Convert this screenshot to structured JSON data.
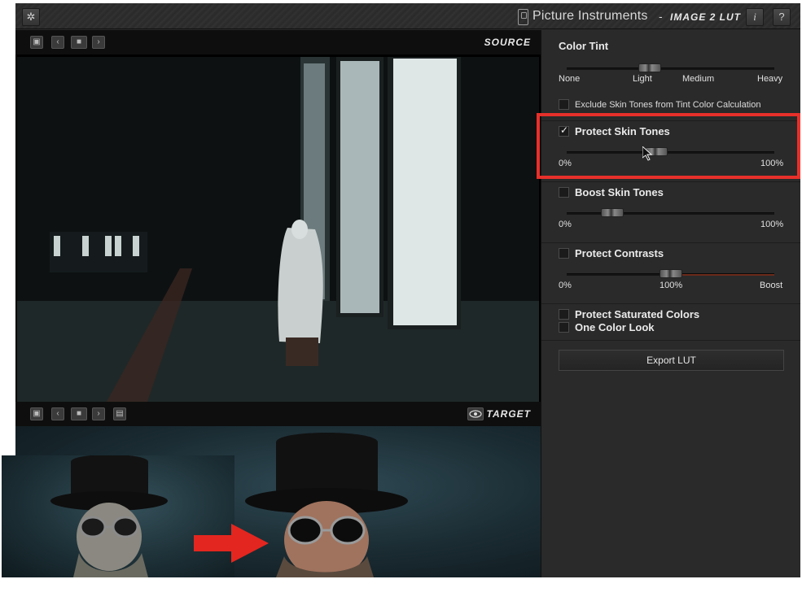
{
  "titlebar": {
    "brand_name": "Picture Instruments",
    "brand_dash": "-",
    "product": "IMAGE 2 LUT",
    "info_label": "i",
    "help_label": "?"
  },
  "source": {
    "label": "SOURCE"
  },
  "target": {
    "label": "TARGET"
  },
  "panel": {
    "color_tint": {
      "title": "Color Tint",
      "ticks": [
        "None",
        "Light",
        "Medium",
        "Heavy"
      ],
      "value_fraction": 0.4
    },
    "exclude_skin": {
      "label": "Exclude Skin Tones from Tint Color Calculation",
      "checked": false
    },
    "protect_skin": {
      "label": "Protect Skin Tones",
      "checked": true,
      "min": "0%",
      "max": "100%",
      "value_fraction": 0.43
    },
    "boost_skin": {
      "label": "Boost Skin Tones",
      "checked": false,
      "min": "0%",
      "max": "100%",
      "value_fraction": 0.22
    },
    "protect_contrasts": {
      "label": "Protect Contrasts",
      "checked": false,
      "min": "0%",
      "mid": "100%",
      "max": "Boost",
      "value_fraction": 0.5
    },
    "protect_saturated": {
      "label": "Protect Saturated Colors",
      "checked": false
    },
    "one_color": {
      "label": "One Color Look",
      "checked": false
    },
    "export_label": "Export LUT"
  },
  "colors": {
    "accent_red": "#e8302a",
    "panel_bg": "#2a2a2a"
  }
}
